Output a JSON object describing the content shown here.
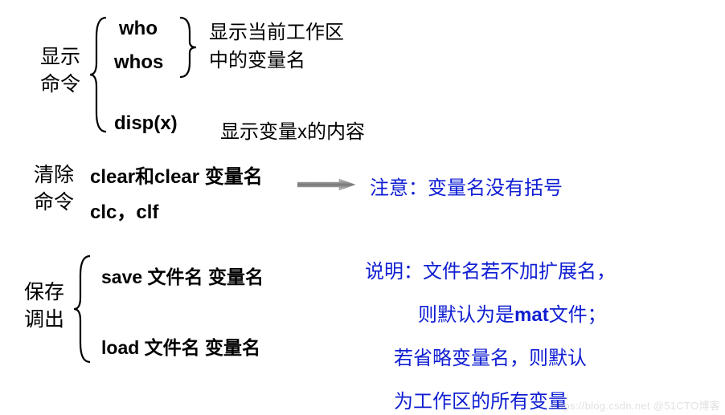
{
  "section1": {
    "label_line1": "显示",
    "label_line2": "命令",
    "item_who": "who",
    "item_whos": "whos",
    "desc1_line1": "显示当前工作区",
    "desc1_line2": "中的变量名",
    "item_disp": "disp(x)",
    "desc_disp": "显示变量x的内容"
  },
  "section2": {
    "label_line1": "清除",
    "label_line2": "命令",
    "item1": "clear和clear 变量名",
    "item2": "clc，clf",
    "note": "注意：变量名没有括号"
  },
  "section3": {
    "label_line1": "保存",
    "label_line2": "调出",
    "item_save": "save 文件名 变量名",
    "item_load": "load 文件名 变量名",
    "explain1": "说明：文件名若不加扩展名，",
    "explain2_pre": "则默认为是",
    "explain2_bold": "mat",
    "explain2_post": "文件；",
    "explain3": "若省略变量名，则默认",
    "explain4": "为工作区的所有变量"
  },
  "watermark": "https://blog.csdn.net @51CTO博客"
}
